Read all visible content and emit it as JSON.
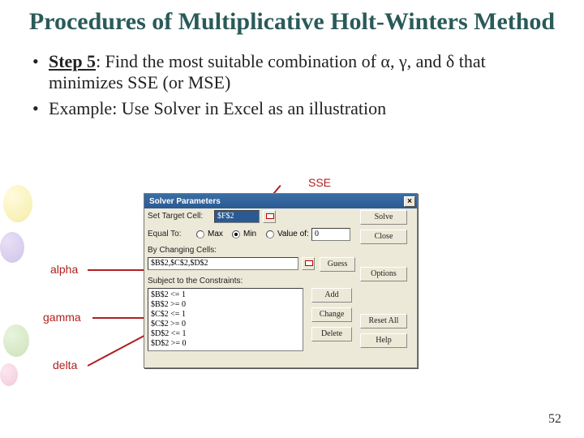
{
  "title": "Procedures of Multiplicative Holt-Winters Method",
  "bullet1_label": "Step 5",
  "bullet1_rest": ": Find the most suitable combination of α, γ, and δ that minimizes SSE (or MSE)",
  "bullet2": "Example: Use Solver in Excel as an illustration",
  "annotations": {
    "sse": "SSE",
    "alpha": "alpha",
    "gamma": "gamma",
    "delta": "delta"
  },
  "pagenum": "52",
  "dialog": {
    "title": "Solver Parameters",
    "close": "×",
    "target_label": "Set Target Cell:",
    "target_value": "$F$2",
    "equal_label": "Equal To:",
    "opt_max": "Max",
    "opt_min": "Min",
    "opt_value": "Value of:",
    "value_of": "0",
    "changing_label": "By Changing Cells:",
    "changing_value": "$B$2,$C$2,$D$2",
    "subject_label": "Subject to the Constraints:",
    "constraints": [
      "$B$2 <= 1",
      "$B$2 >= 0",
      "$C$2 <= 1",
      "$C$2 >= 0",
      "$D$2 <= 1",
      "$D$2 >= 0"
    ],
    "btn_solve": "Solve",
    "btn_close": "Close",
    "btn_guess": "Guess",
    "btn_options": "Options",
    "btn_add": "Add",
    "btn_change": "Change",
    "btn_delete": "Delete",
    "btn_reset": "Reset All",
    "btn_help": "Help"
  }
}
